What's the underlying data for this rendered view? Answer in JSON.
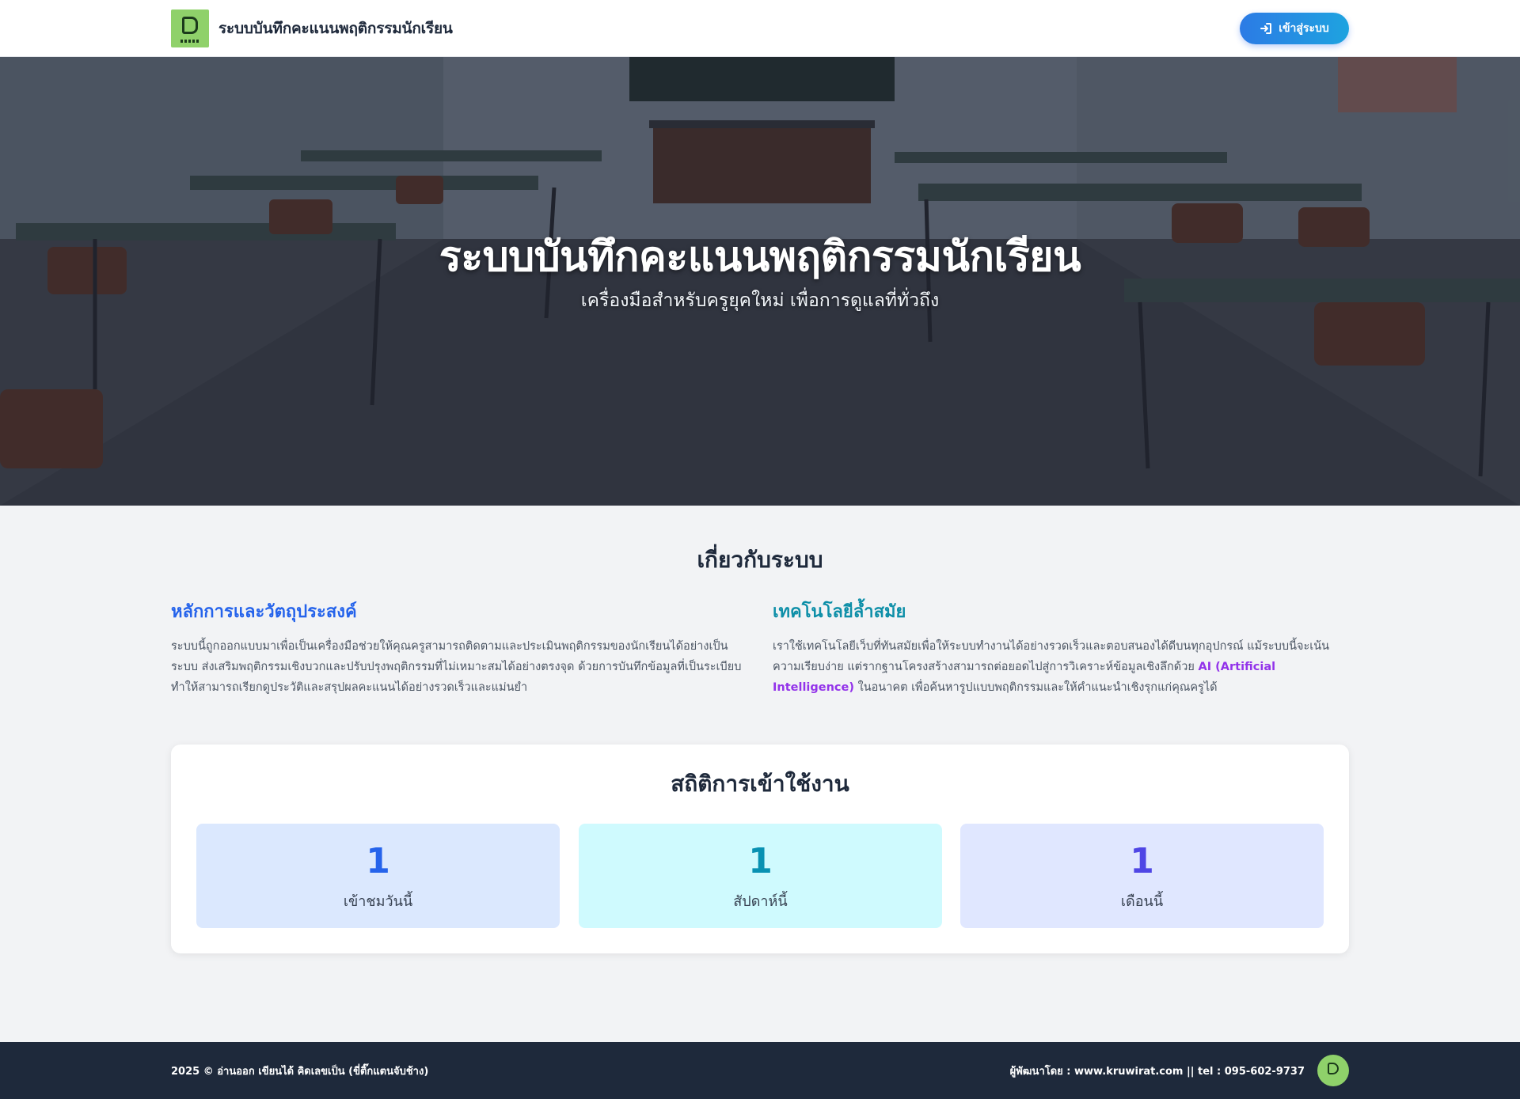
{
  "header": {
    "title": "ระบบบันทึกคะแนนพฤติกรรมนักเรียน",
    "login_label": "เข้าสู่ระบบ",
    "logo_icon": "school-logo",
    "login_icon": "sign-in-icon"
  },
  "hero": {
    "title": "ระบบบันทึกคะแนนพฤติกรรมนักเรียน",
    "subtitle": "เครื่องมือสำหรับครูยุคใหม่ เพื่อการดูแลที่ทั่วถึง"
  },
  "about": {
    "heading": "เกี่ยวกับระบบ",
    "principles": {
      "title": "หลักการและวัตถุประสงค์",
      "text": "ระบบนี้ถูกออกแบบมาเพื่อเป็นเครื่องมือช่วยให้คุณครูสามารถติดตามและประเมินพฤติกรรมของนักเรียนได้อย่างเป็นระบบ ส่งเสริมพฤติกรรมเชิงบวกและปรับปรุงพฤติกรรมที่ไม่เหมาะสมได้อย่างตรงจุด ด้วยการบันทึกข้อมูลที่เป็นระเบียบ ทำให้สามารถเรียกดูประวัติและสรุปผลคะแนนได้อย่างรวดเร็วและแม่นยำ"
    },
    "technology": {
      "title": "เทคโนโลยีล้ำสมัย",
      "text_before": "เราใช้เทคโนโลยีเว็บที่ทันสมัยเพื่อให้ระบบทำงานได้อย่างรวดเร็วและตอบสนองได้ดีบนทุกอุปกรณ์ แม้ระบบนี้จะเน้นความเรียบง่าย แต่รากฐานโครงสร้างสามารถต่อยอดไปสู่การวิเคราะห์ข้อมูลเชิงลึกด้วย ",
      "highlight": "AI (Artificial Intelligence)",
      "text_after": " ในอนาคต เพื่อค้นหารูปแบบพฤติกรรมและให้คำแนะนำเชิงรุกแก่คุณครูได้"
    }
  },
  "stats": {
    "title": "สถิติการเข้าใช้งาน",
    "items": [
      {
        "value": "1",
        "label": "เข้าชมวันนี้",
        "color": "#2563eb"
      },
      {
        "value": "1",
        "label": "สัปดาห์นี้",
        "color": "#0891b2"
      },
      {
        "value": "1",
        "label": "เดือนนี้",
        "color": "#4f46e5"
      }
    ]
  },
  "footer": {
    "left": "2025 © อ่านออก เขียนได้ คิดเลขเป็น (ขี่ติ๊กแตนจับช้าง)",
    "right": "ผู้พัฒนาโดย : www.kruwirat.com || tel : 095-602-9737"
  },
  "colors": {
    "primary": "#2563eb",
    "teal": "#0e8fa8",
    "ai_purple": "#9333ea",
    "footer_bg": "#1e293b"
  }
}
